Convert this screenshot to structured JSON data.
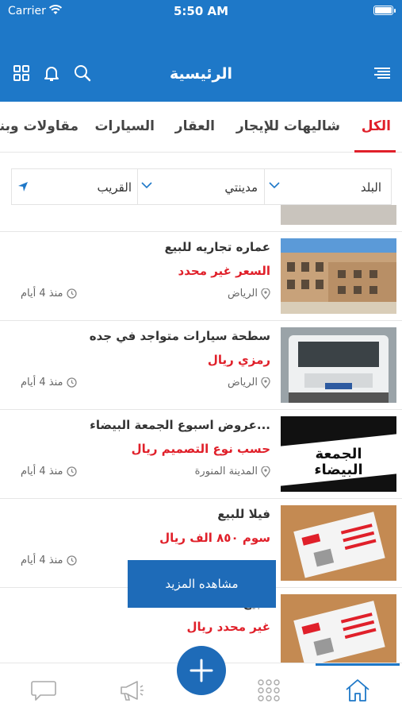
{
  "status_bar": {
    "carrier": "Carrier",
    "time": "5:50 AM"
  },
  "header": {
    "title": "الرئيسية"
  },
  "tabs": [
    {
      "label": "الكل",
      "active": true
    },
    {
      "label": "شاليهات للإيجار"
    },
    {
      "label": "العقار"
    },
    {
      "label": "السيارات"
    },
    {
      "label": "مقاولات وبناء"
    }
  ],
  "filters": {
    "country": "البلد",
    "city": "مدينتي",
    "nearby": "القريب"
  },
  "listings": [
    {
      "title": "عماره تجاريه للبيع",
      "price": "السعر غير محدد",
      "location": "الرياض",
      "time": "منذ 4 أيام"
    },
    {
      "title": "سطحة سيارات متواجد في جده",
      "price": "رمزي ريال",
      "location": "الرياض",
      "time": "منذ 4 أيام"
    },
    {
      "title": "عروض اسبوع الجمعة البيضاء...",
      "price": "حسب نوع التصميم ريال",
      "location": "المدينة المنورة",
      "time": "منذ 4 أيام",
      "thumb_text": "الجمعة البيضاء"
    },
    {
      "title": "فيلا للبيع",
      "price": "سوم ٨٥٠ الف ريال",
      "location": "",
      "time": "منذ 4 أيام"
    },
    {
      "title": "للبيع",
      "price": "غير محدد ريال",
      "location": "",
      "time": ""
    }
  ],
  "more_button": "مشاهده المزيد",
  "colors": {
    "primary": "#1e78c8",
    "accent": "#e0202a"
  }
}
